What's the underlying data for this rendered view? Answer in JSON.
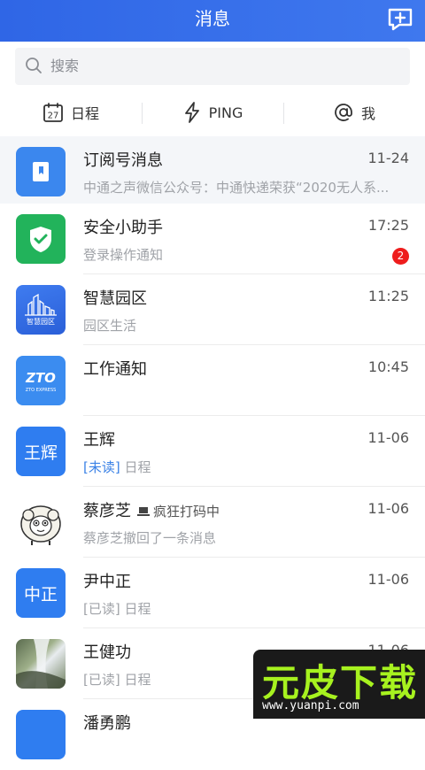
{
  "header": {
    "title": "消息"
  },
  "search": {
    "placeholder": "搜索"
  },
  "quick_actions": [
    {
      "label": "日程",
      "icon": "calendar-icon",
      "day": "27"
    },
    {
      "label": "PING",
      "icon": "lightning-icon"
    },
    {
      "label": "我",
      "icon": "at-icon"
    }
  ],
  "messages": [
    {
      "name": "订阅号消息",
      "time": "11-24",
      "preview": "中通之声微信公众号：中通快递荣获“2020无人系...",
      "avatar_icon": "bookmark-icon",
      "avatar_color": "#3b87ee"
    },
    {
      "name": "安全小助手",
      "time": "17:25",
      "preview": "登录操作通知",
      "badge": "2",
      "avatar_icon": "shield-check-icon",
      "avatar_color": "#22b35b"
    },
    {
      "name": "智慧园区",
      "time": "11:25",
      "preview": "园区生活",
      "avatar_text": "智慧园区",
      "avatar_color": "#2f6ee8"
    },
    {
      "name": "工作通知",
      "time": "10:45",
      "preview": "",
      "avatar_text": "ZTO",
      "avatar_sub": "ZTO EXPRESS",
      "avatar_color": "#3b8cf0"
    },
    {
      "name": "王辉",
      "time": "11-06",
      "tag": "[未读]",
      "preview": "日程",
      "avatar_text": "王辉",
      "avatar_color": "#2f7df0"
    },
    {
      "name": "蔡彦芝",
      "status": "疯狂打码中",
      "time": "11-06",
      "preview": "蔡彦芝撤回了一条消息",
      "avatar_icon": "sheep-avatar"
    },
    {
      "name": "尹中正",
      "time": "11-06",
      "tag_read": "[已读]",
      "preview": "日程",
      "avatar_text": "中正",
      "avatar_color": "#2f7df0"
    },
    {
      "name": "王健功",
      "time": "11-06",
      "tag_read": "[已读]",
      "preview": "日程",
      "avatar_icon": "waterfall-photo"
    },
    {
      "name": "潘勇鹏",
      "avatar_color": "#2f7df0"
    }
  ],
  "watermark": {
    "text": "元皮下载",
    "url": "www.yuanpi.com"
  },
  "colors": {
    "header_start": "#2f66e6",
    "header_end": "#3f78ee",
    "badge": "#ee1c1c",
    "unread_tag": "#3b82e6"
  }
}
